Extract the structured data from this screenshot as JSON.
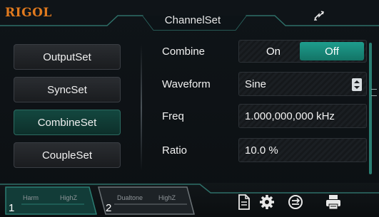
{
  "brand": "RIGOL",
  "title": "ChannelSet",
  "left_menu": [
    {
      "label": "OutputSet",
      "active": false
    },
    {
      "label": "SyncSet",
      "active": false
    },
    {
      "label": "CombineSet",
      "active": true
    },
    {
      "label": "CoupleSet",
      "active": false
    }
  ],
  "params": {
    "combine": {
      "label": "Combine",
      "on": "On",
      "off": "Off",
      "selected": "Off"
    },
    "waveform": {
      "label": "Waveform",
      "value": "Sine"
    },
    "freq": {
      "label": "Freq",
      "value": "1.000,000,000 kHz"
    },
    "ratio": {
      "label": "Ratio",
      "value": "10.0 %"
    }
  },
  "channels": [
    {
      "number": "1",
      "mode": "Harm",
      "impedance": "HighZ"
    },
    {
      "number": "2",
      "mode": "Dualtone",
      "impedance": "HighZ"
    }
  ],
  "icons": {
    "swap": "swap-arrows-icon",
    "file": "file-icon",
    "settings": "gear-icon",
    "transfer": "transfer-icon",
    "print": "printer-icon"
  },
  "colors": {
    "accent": "#1e9d8d",
    "brand": "#e07a1e",
    "active_menu": "#13473f"
  }
}
